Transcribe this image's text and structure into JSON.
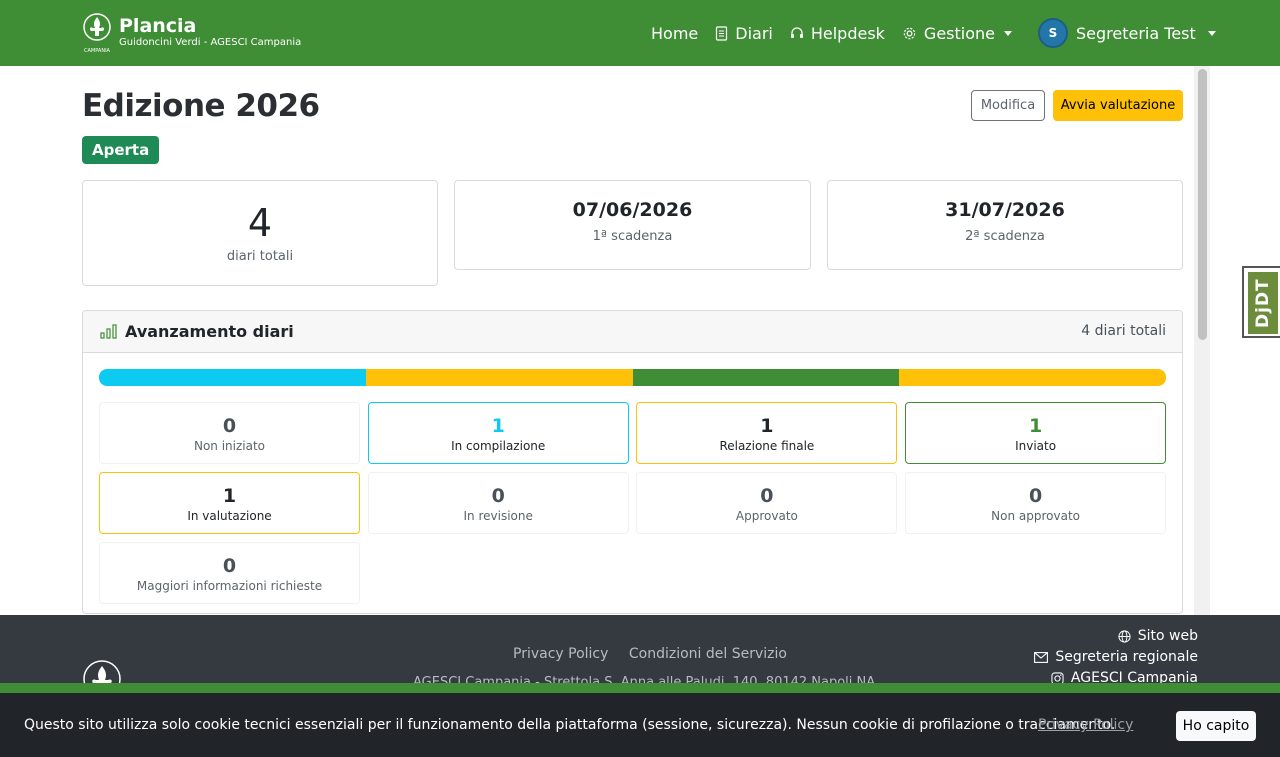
{
  "navbar": {
    "brand_title": "Plancia",
    "brand_subtitle": "Guidoncini Verdi - AGESCI Campania",
    "logo_caption": "CAMPANIA",
    "items": [
      {
        "label": "Home"
      },
      {
        "label": "Diari",
        "icon": "journal-icon"
      },
      {
        "label": "Helpdesk",
        "icon": "headset-icon"
      },
      {
        "label": "Gestione",
        "icon": "gear-icon"
      }
    ],
    "user_initial": "S",
    "user_name": "Segreteria Test"
  },
  "page": {
    "title": "Edizione 2026",
    "status": "Aperta",
    "edit_label": "Modifica",
    "start_eval_label": "Avvia valutazione"
  },
  "stats": {
    "total_value": "4",
    "total_label": "diari totali",
    "deadline1_value": "07/06/2026",
    "deadline1_label": "1ª scadenza",
    "deadline2_value": "31/07/2026",
    "deadline2_label": "2ª scadenza"
  },
  "progress": {
    "title": "Avanzamento diari",
    "count_label": "4 diari totali",
    "bar_segments": [
      {
        "status": "In compilazione",
        "fraction": 0.25,
        "color": "#0dcaf0"
      },
      {
        "status": "Relazione finale",
        "fraction": 0.25,
        "color": "#ffc107"
      },
      {
        "status": "Inviato",
        "fraction": 0.25,
        "color": "#3f8d35"
      },
      {
        "status": "In valutazione",
        "fraction": 0.25,
        "color": "#ffc107"
      }
    ],
    "tiles": [
      {
        "value": "0",
        "label": "Non iniziato",
        "color": ""
      },
      {
        "value": "1",
        "label": "In compilazione",
        "color": "#0dcaf0"
      },
      {
        "value": "1",
        "label": "Relazione finale",
        "color": "#ffc107"
      },
      {
        "value": "1",
        "label": "Inviato",
        "color": "#3f8d35"
      },
      {
        "value": "1",
        "label": "In valutazione",
        "color": "#ffc107"
      },
      {
        "value": "0",
        "label": "In revisione",
        "color": ""
      },
      {
        "value": "0",
        "label": "Approvato",
        "color": ""
      },
      {
        "value": "0",
        "label": "Non approvato",
        "color": ""
      },
      {
        "value": "0",
        "label": "Maggiori informazioni richieste",
        "color": ""
      }
    ]
  },
  "footer": {
    "privacy": "Privacy Policy",
    "terms": "Condizioni del Servizio",
    "address": "AGESCI Campania - Strettola S. Anna alle Paludi, 140, 80142 Napoli NA",
    "website": "Sito web",
    "secretariat": "Segreteria regionale",
    "instagram": "AGESCI Campania"
  },
  "cookie": {
    "text": "Questo sito utilizza solo cookie tecnici essenziali per il funzionamento della piattaforma (sessione, sicurezza). Nessun cookie di profilazione o tracciamento.",
    "link": "Privacy Policy",
    "button": "Ho capito"
  },
  "debug_toolbar": {
    "label": "DjDT"
  },
  "colors": {
    "brand_green": "#3f8d35",
    "badge_green": "#1e8a55",
    "warning": "#ffc107",
    "info": "#0dcaf0",
    "footer_bg": "#343a40",
    "cookie_bg": "#212529"
  }
}
